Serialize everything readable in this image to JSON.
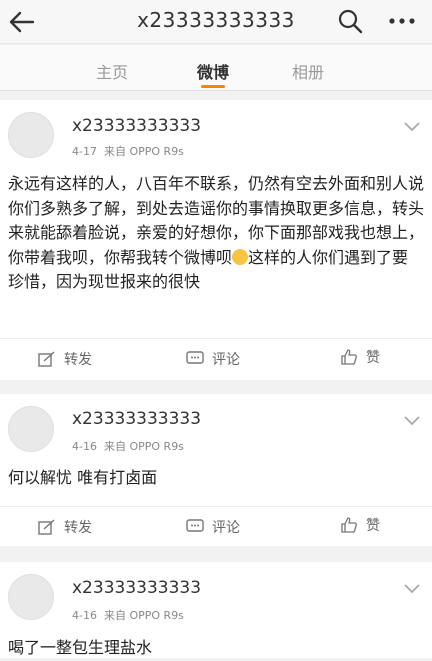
{
  "header": {
    "title": "x23333333333"
  },
  "tabs": [
    {
      "label": "主页"
    },
    {
      "label": "微博"
    },
    {
      "label": "相册"
    }
  ],
  "posts": [
    {
      "username": "x23333333333",
      "date": "4-17",
      "source": "来自 OPPO R9s",
      "content_before_emoji": "永远有这样的人，八百年不联系，仍然有空去外面和别人说你们多熟多了解，到处去造谣你的事情换取更多信息，转头来就能舔着脸说，亲爱的好想你，你下面那部戏我也想上，你带着我呗，你帮我转个微博呗",
      "content_after_emoji": "这样的人你们遇到了要珍惜，因为现世报来的很快",
      "actions": {
        "repost": "转发",
        "comment": "评论",
        "like": "赞"
      }
    },
    {
      "username": "x23333333333",
      "date": "4-16",
      "source": "来自 OPPO R9s",
      "content": "何以解忧 唯有打卤面",
      "actions": {
        "repost": "转发",
        "comment": "评论",
        "like": "赞"
      }
    },
    {
      "username": "x23333333333",
      "date": "4-16",
      "source": "来自 OPPO R9s",
      "content": "喝了一整包生理盐水"
    }
  ],
  "icons": {
    "back": "back-arrow-icon",
    "search": "search-icon",
    "more": "more-icon",
    "chevron": "chevron-down-icon",
    "repost": "repost-icon",
    "comment": "comment-icon",
    "like": "thumbs-up-icon"
  },
  "colors": {
    "accent": "#ff8200",
    "background": "#f2f2f2"
  }
}
